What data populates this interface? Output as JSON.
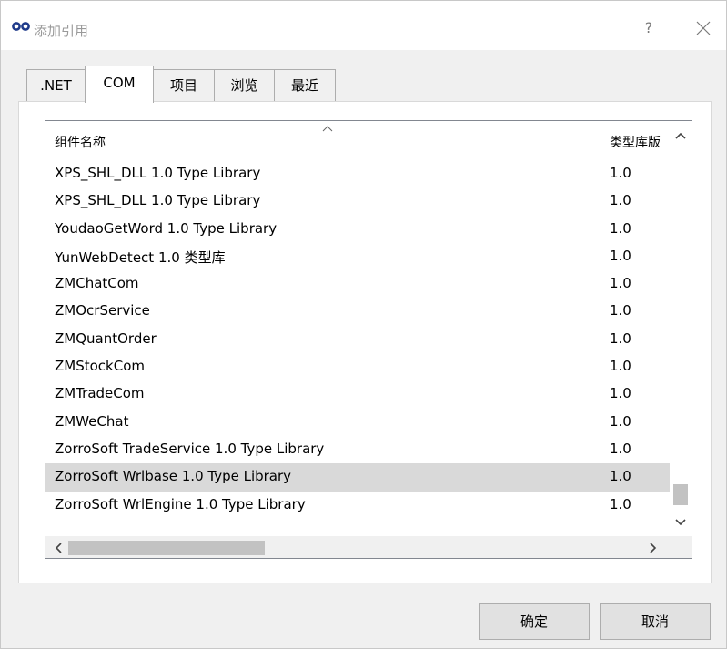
{
  "window": {
    "title": "添加引用",
    "help_label": "?"
  },
  "tabs": [
    {
      "label": ".NET",
      "active": false
    },
    {
      "label": "COM",
      "active": true
    },
    {
      "label": "项目",
      "active": false
    },
    {
      "label": "浏览",
      "active": false
    },
    {
      "label": "最近",
      "active": false
    }
  ],
  "list": {
    "columns": {
      "name": "组件名称",
      "version": "类型库版"
    },
    "rows": [
      {
        "name": "XPS_SHL_DLL 1.0 Type Library",
        "version": "1.0"
      },
      {
        "name": "XPS_SHL_DLL 1.0 Type Library",
        "version": "1.0"
      },
      {
        "name": "YoudaoGetWord 1.0 Type Library",
        "version": "1.0"
      },
      {
        "name": "YunWebDetect 1.0 类型库",
        "version": "1.0"
      },
      {
        "name": "ZMChatCom",
        "version": "1.0"
      },
      {
        "name": "ZMOcrService",
        "version": "1.0"
      },
      {
        "name": "ZMQuantOrder",
        "version": "1.0"
      },
      {
        "name": "ZMStockCom",
        "version": "1.0"
      },
      {
        "name": "ZMTradeCom",
        "version": "1.0"
      },
      {
        "name": "ZMWeChat",
        "version": "1.0"
      },
      {
        "name": "ZorroSoft TradeService 1.0 Type Library",
        "version": "1.0"
      },
      {
        "name": "ZorroSoft Wrlbase 1.0 Type Library",
        "version": "1.0"
      },
      {
        "name": "ZorroSoft WrlEngine 1.0 Type Library",
        "version": "1.0"
      }
    ],
    "selected_index": 11
  },
  "buttons": {
    "ok": "确定",
    "cancel": "取消"
  },
  "colors": {
    "selected_row": "#d9d9d9",
    "button_face": "#e1e1e1",
    "title_icon": "#1e3a8a"
  }
}
